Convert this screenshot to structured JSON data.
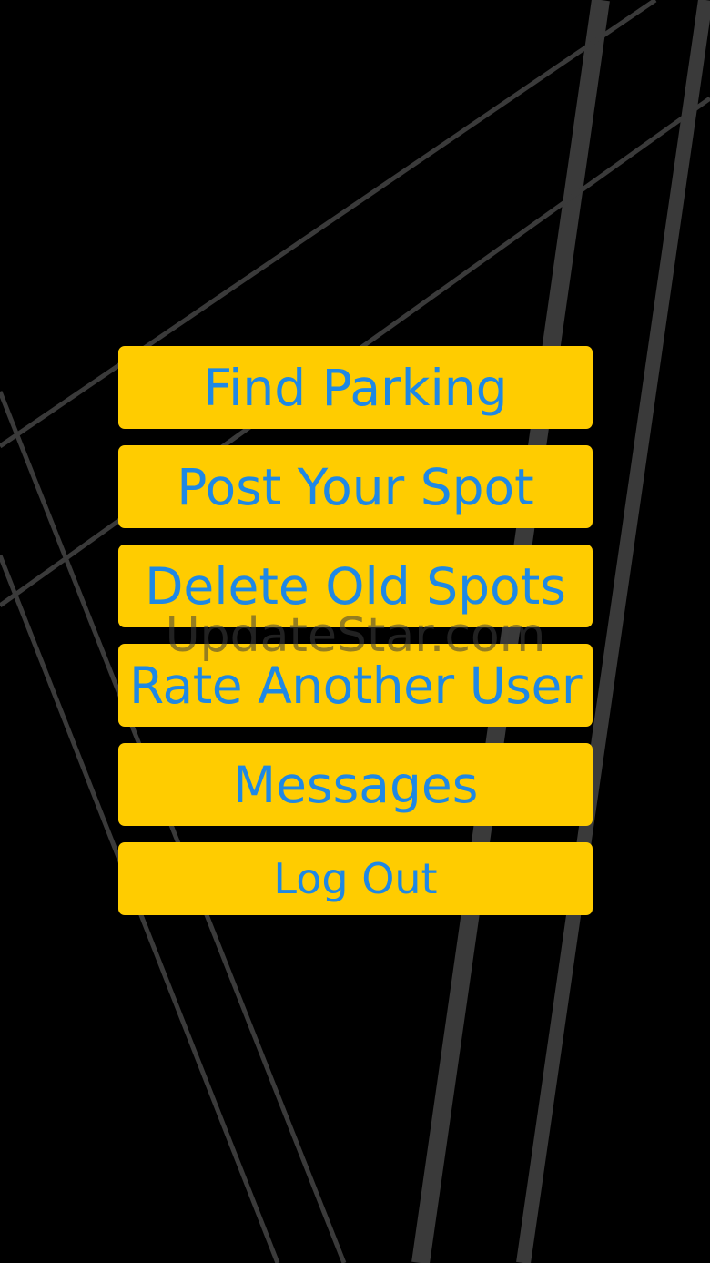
{
  "menu": {
    "items": [
      {
        "label": "Find Parking"
      },
      {
        "label": "Post Your Spot"
      },
      {
        "label": "Delete Old Spots"
      },
      {
        "label": "Rate Another User"
      },
      {
        "label": "Messages"
      },
      {
        "label": "Log Out"
      }
    ]
  },
  "watermark": "UpdateStar.com",
  "colors": {
    "background": "#000000",
    "button_fill": "#FFCC00",
    "button_text": "#1E88E5",
    "lines": "#3A3A3A"
  }
}
